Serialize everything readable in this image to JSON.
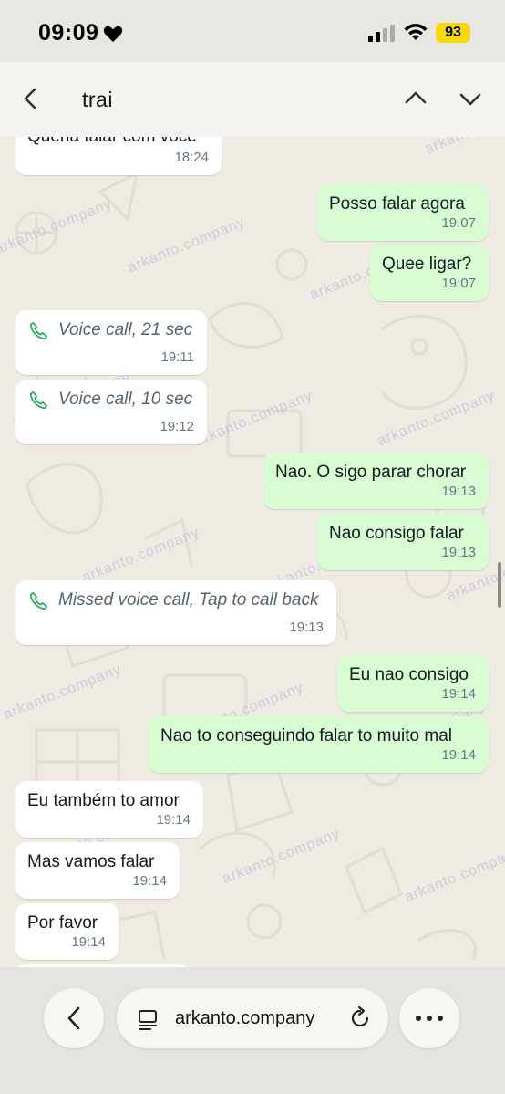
{
  "status_bar": {
    "time": "09:09",
    "battery": "93"
  },
  "search": {
    "query": "trai"
  },
  "messages": [
    {
      "direction": "in",
      "text": "Queria falar com você",
      "time": "18:24"
    },
    {
      "direction": "out",
      "text": "Posso falar agora",
      "time": "19:07"
    },
    {
      "direction": "out",
      "text": "Quee ligar?",
      "time": "19:07"
    },
    {
      "direction": "in",
      "type": "call",
      "text": "Voice call, 21 sec",
      "time": "19:11"
    },
    {
      "direction": "in",
      "type": "call",
      "text": "Voice call, 10 sec",
      "time": "19:12"
    },
    {
      "direction": "out",
      "text": "Nao. O sigo parar chorar",
      "time": "19:13"
    },
    {
      "direction": "out",
      "text": "Nao consigo falar",
      "time": "19:13"
    },
    {
      "direction": "in",
      "type": "call",
      "text": "Missed voice call, Tap to call back",
      "time": "19:13"
    },
    {
      "direction": "out",
      "text": "Eu nao consigo",
      "time": "19:14"
    },
    {
      "direction": "out",
      "text": "Nao to conseguindo falar to muito mal",
      "time": "19:14"
    },
    {
      "direction": "in",
      "text": "Eu também to amor",
      "time": "19:14"
    },
    {
      "direction": "in",
      "text": "Mas vamos falar",
      "time": "19:14"
    },
    {
      "direction": "in",
      "text": "Por favor",
      "time": "19:14"
    }
  ],
  "watermark": "arkanto.company",
  "browser": {
    "address": "arkanto.company"
  },
  "icons": {
    "status": [
      "heart-icon",
      "signal-icon",
      "wifi-icon"
    ],
    "header": [
      "back-arrow-icon",
      "chevron-up-icon",
      "chevron-down-icon"
    ],
    "browser": [
      "browser-back-icon",
      "reader-icon",
      "reload-icon",
      "more-icon"
    ],
    "call": "phone-icon"
  },
  "colors": {
    "incoming_bubble": "#ffffff",
    "outgoing_bubble": "#d9fdd3",
    "call_icon": "#1fa855",
    "battery": "#f5d90a"
  }
}
